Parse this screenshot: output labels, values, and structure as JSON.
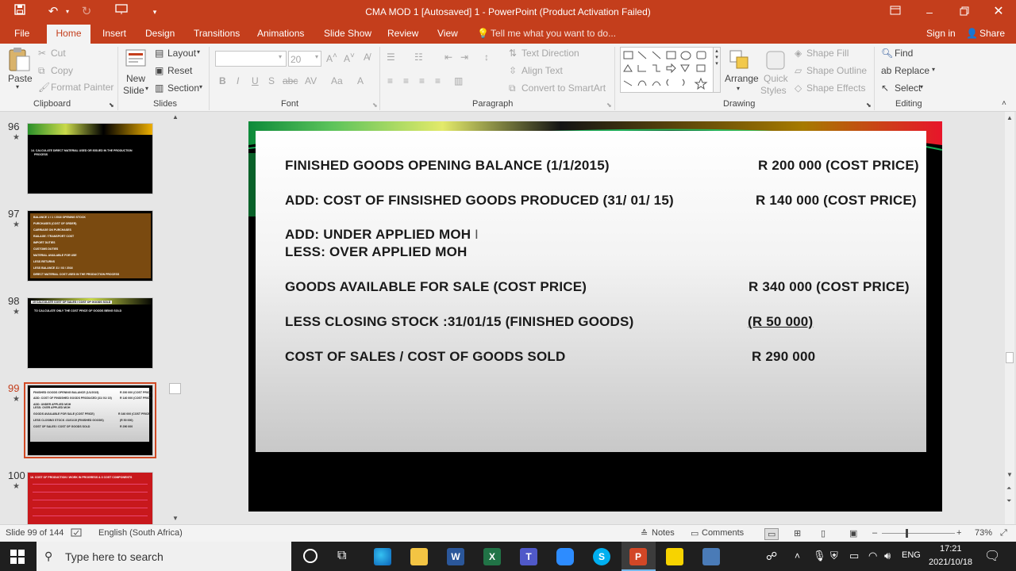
{
  "window": {
    "title": "CMA MOD 1 [Autosaved] 1 - PowerPoint (Product Activation Failed)"
  },
  "tabs": {
    "file": "File",
    "home": "Home",
    "insert": "Insert",
    "design": "Design",
    "transitions": "Transitions",
    "animations": "Animations",
    "slideshow": "Slide Show",
    "review": "Review",
    "view": "View",
    "tellme": "Tell me what you want to do...",
    "signin": "Sign in",
    "share": "Share"
  },
  "ribbon": {
    "clipboard": {
      "paste": "Paste",
      "cut": "Cut",
      "copy": "Copy",
      "format_painter": "Format Painter",
      "label": "Clipboard"
    },
    "slides": {
      "new_slide_1": "New",
      "new_slide_2": "Slide",
      "layout": "Layout",
      "reset": "Reset",
      "section": "Section",
      "label": "Slides"
    },
    "font": {
      "size": "20",
      "label": "Font"
    },
    "paragraph": {
      "text_direction": "Text Direction",
      "align_text": "Align Text",
      "smartart": "Convert to SmartArt",
      "label": "Paragraph"
    },
    "drawing": {
      "arrange": "Arrange",
      "quick_styles_1": "Quick",
      "quick_styles_2": "Styles",
      "shape_fill": "Shape Fill",
      "shape_outline": "Shape Outline",
      "shape_effects": "Shape Effects",
      "label": "Drawing"
    },
    "editing": {
      "find": "Find",
      "replace": "Replace",
      "select": "Select",
      "label": "Editing"
    }
  },
  "thumbnails": [
    {
      "number": "96",
      "line1": "14. CALCULATE DIRECT MATERIAL USED OR ISSUED IN THE PRODUCTION",
      "line2": "PROCESS"
    },
    {
      "number": "97",
      "rows": [
        "BALANCE 1 / 1 / 2016 OPENING STOCK",
        "PURCHASES (COST OF ORDER)",
        "CARRIAGE ON PURCHASES",
        "RAILAGE / TRANSPORT COST",
        "IMPORT DUTIES",
        "CUSTOMS DUTIES",
        "MATERIAL AVAILABLE FOR USE",
        "LESS RETURNS",
        "LESS BALANCE 31 / 03 / 2016",
        "DIRECT MATERIAL COST USED IN THE PRODUCTION PROCESS"
      ]
    },
    {
      "number": "98",
      "line1": "15 CALCULATE COST OF SALES / COST OF GOODS SOLD",
      "line2": "TO CALCULATE ONLY THE COST PRICE OF GOODS BEING SOLD"
    },
    {
      "number": "99"
    },
    {
      "number": "100",
      "line1": "16. COST OF PRODUCTION / WORK IN PROGRESS & 3 COST COMPONENTS"
    }
  ],
  "slide": {
    "rows": [
      {
        "left": "FINISHED GOODS OPENING BALANCE (1/1/2015)",
        "right": "R 200 000 (COST PRICE)"
      },
      {
        "left": "ADD: COST OF FINSISHED GOODS PRODUCED (31/ 01/ 15)",
        "right": "R 140 000  (COST PRICE)"
      },
      {
        "left": "ADD: UNDER APPLIED  MOH",
        "right": ""
      },
      {
        "left": "LESS: OVER APPLIED    MOH",
        "right": ""
      },
      {
        "left": "GOODS AVAILABLE FOR SALE (COST PRICE)",
        "right": "R 340 000 (COST PRICE)"
      },
      {
        "left": "LESS  CLOSING STOCK :31/01/15 (FINISHED GOODS)",
        "right": "(R 50 000)"
      },
      {
        "left": "COST OF SALES / COST OF GOODS SOLD",
        "right": "R 290 000"
      }
    ]
  },
  "status": {
    "slide": "Slide 99 of 144",
    "language": "English (South Africa)",
    "notes": "Notes",
    "comments": "Comments",
    "zoom": "73%"
  },
  "taskbar": {
    "search": "Type here to search",
    "lang": "ENG",
    "time": "17:21",
    "date": "2021/10/18"
  },
  "colors": {
    "accent": "#c43e1c"
  }
}
